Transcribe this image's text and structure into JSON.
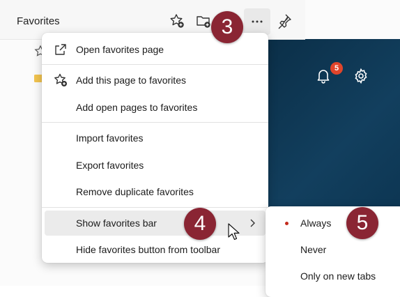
{
  "panel": {
    "title": "Favorites"
  },
  "header_icons": [
    "add-favorite-icon",
    "add-folder-icon",
    "more-options-icon",
    "pin-icon"
  ],
  "notifications": {
    "badge_count": "5"
  },
  "menu": {
    "items": [
      {
        "label": "Open favorites page",
        "icon": "open-external-icon"
      },
      {
        "label": "Add this page to favorites",
        "icon": "star-add-icon"
      },
      {
        "label": "Add open pages to favorites"
      },
      {
        "label": "Import favorites"
      },
      {
        "label": "Export favorites"
      },
      {
        "label": "Remove duplicate favorites"
      },
      {
        "label": "Show favorites bar",
        "state": "hovered",
        "has_submenu": true
      },
      {
        "label": "Hide favorites button from toolbar"
      }
    ]
  },
  "submenu": {
    "items": [
      {
        "label": "Always",
        "selected": true
      },
      {
        "label": "Never"
      },
      {
        "label": "Only on new tabs"
      }
    ]
  },
  "callouts": [
    "3",
    "4",
    "5"
  ],
  "colors": {
    "callout": "#8a2533",
    "hover": "#ebebeb",
    "selected_dot": "#c42b1c",
    "dark_background": "#0e3550",
    "badge": "#e0452b"
  }
}
